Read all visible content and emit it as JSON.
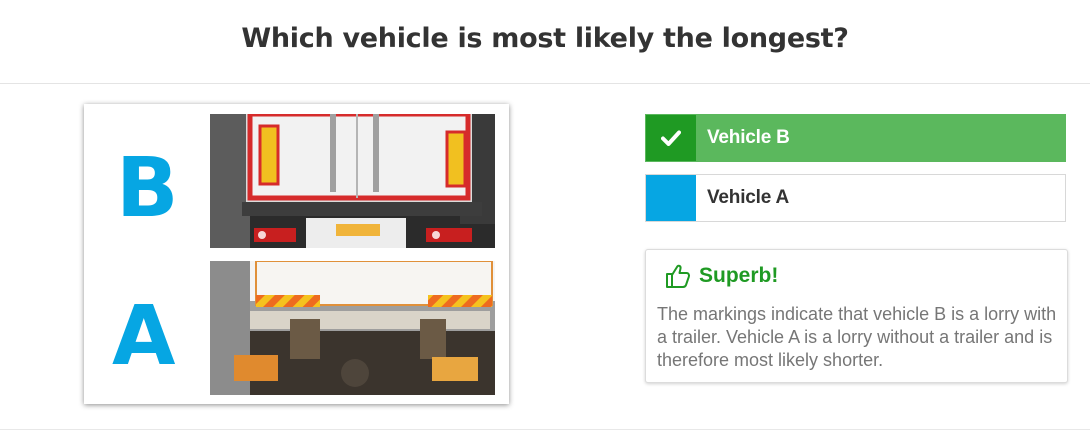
{
  "question": "Which vehicle is most likely the longest?",
  "image_labels": {
    "top": "B",
    "bottom": "A"
  },
  "answers": [
    {
      "label": "Vehicle B",
      "state": "correct",
      "icon": "check-icon"
    },
    {
      "label": "Vehicle A",
      "state": "unselected",
      "icon": "none"
    }
  ],
  "feedback": {
    "title": "Superb!",
    "icon": "thumbs-up-icon",
    "text": "The markings indicate that vehicle B is a lorry with a trailer. Vehicle A is a lorry without a trailer and is therefore most likely shorter."
  },
  "colors": {
    "letter": "#06a6e3",
    "correct_bg": "#5bb85d",
    "correct_marker": "#1f9a23",
    "neutral_marker": "#06a6e3",
    "feedback_title": "#1f9a23"
  }
}
